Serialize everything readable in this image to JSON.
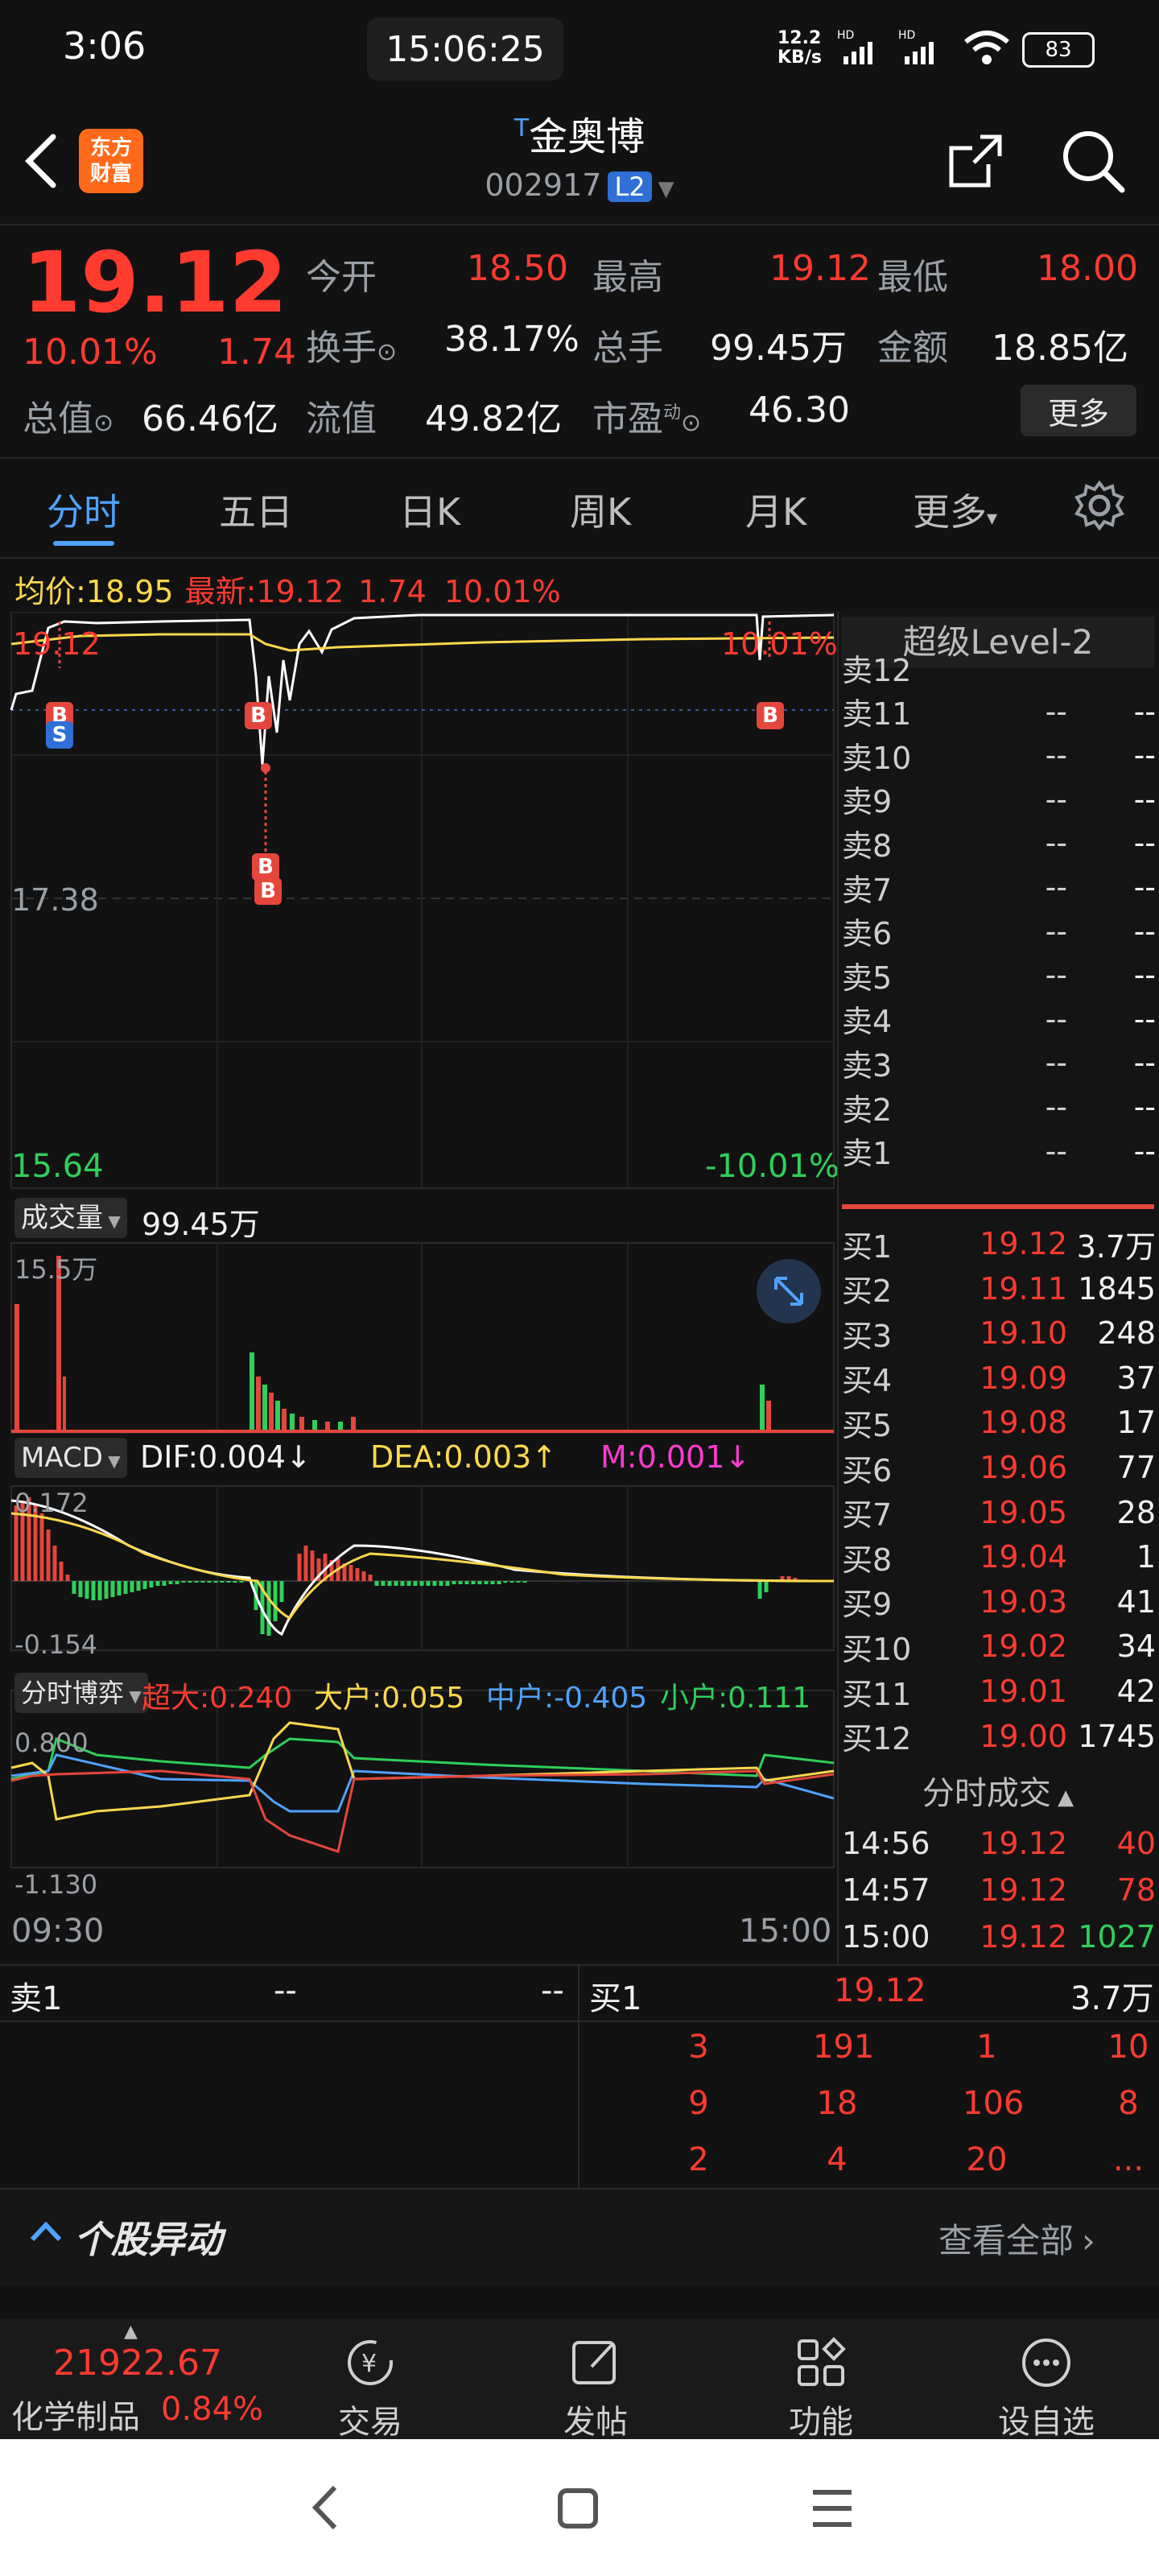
{
  "status_bar": {
    "time": "3:06",
    "center_time": "15:06:25",
    "net_speed_top": "12.2",
    "net_speed_bottom": "KB/s",
    "signal1": "HD",
    "signal2": "HD",
    "battery": "83"
  },
  "header": {
    "title_marker": "T",
    "title": "金奥博",
    "code": "002917",
    "level": "L2"
  },
  "quote": {
    "price": "19.12",
    "change_pct": "10.01%",
    "change": "1.74",
    "open_label": "今开",
    "open": "18.50",
    "high_label": "最高",
    "high": "19.12",
    "low_label": "最低",
    "low": "18.00",
    "turnover_label": "换手",
    "turnover": "38.17%",
    "volume_label": "总手",
    "volume": "99.45万",
    "amount_label": "金额",
    "amount": "18.85亿",
    "mktcap_label": "总值",
    "mktcap": "66.46亿",
    "float_label": "流值",
    "float": "49.82亿",
    "pe_label": "市盈",
    "pe_sup": "动",
    "pe": "46.30",
    "more": "更多"
  },
  "tabs": {
    "t1": "分时",
    "t2": "五日",
    "t3": "日K",
    "t4": "周K",
    "t5": "月K",
    "t6": "更多"
  },
  "intraday": {
    "avg_label": "均价:",
    "avg": "18.95",
    "last_label": "最新:",
    "last": "19.12",
    "last_chg": "1.74",
    "last_pct": "10.01%",
    "top_price": "19.12",
    "top_pct": "10.01%",
    "mid_price": "17.38",
    "low_price": "15.64",
    "low_pct": "-10.01%"
  },
  "volume_panel": {
    "label": "成交量",
    "value": "99.45万",
    "scale": "15.5万"
  },
  "macd_panel": {
    "label": "MACD",
    "dif": "DIF:0.004↓",
    "dea": "DEA:0.003↑",
    "m": "M:0.001↓",
    "top": "0.172",
    "bottom": "-0.154"
  },
  "flow_panel": {
    "label": "分时博弈",
    "super": "超大:0.240",
    "large": "大户:0.055",
    "mid": "中户:-0.405",
    "small": "小户:0.111",
    "top": "0.800",
    "bottom": "-1.130"
  },
  "time_axis": {
    "start": "09:30",
    "end": "15:00"
  },
  "level2": {
    "title": "超级Level-2",
    "sells": [
      {
        "label": "卖12",
        "price": "",
        "qty": ""
      },
      {
        "label": "卖11",
        "price": "--",
        "qty": "--"
      },
      {
        "label": "卖10",
        "price": "--",
        "qty": "--"
      },
      {
        "label": "卖9",
        "price": "--",
        "qty": "--"
      },
      {
        "label": "卖8",
        "price": "--",
        "qty": "--"
      },
      {
        "label": "卖7",
        "price": "--",
        "qty": "--"
      },
      {
        "label": "卖6",
        "price": "--",
        "qty": "--"
      },
      {
        "label": "卖5",
        "price": "--",
        "qty": "--"
      },
      {
        "label": "卖4",
        "price": "--",
        "qty": "--"
      },
      {
        "label": "卖3",
        "price": "--",
        "qty": "--"
      },
      {
        "label": "卖2",
        "price": "--",
        "qty": "--"
      },
      {
        "label": "卖1",
        "price": "--",
        "qty": "--"
      }
    ],
    "buys": [
      {
        "label": "买1",
        "price": "19.12",
        "qty": "3.7万"
      },
      {
        "label": "买2",
        "price": "19.11",
        "qty": "1845"
      },
      {
        "label": "买3",
        "price": "19.10",
        "qty": "248"
      },
      {
        "label": "买4",
        "price": "19.09",
        "qty": "37"
      },
      {
        "label": "买5",
        "price": "19.08",
        "qty": "17"
      },
      {
        "label": "买6",
        "price": "19.06",
        "qty": "77"
      },
      {
        "label": "买7",
        "price": "19.05",
        "qty": "28"
      },
      {
        "label": "买8",
        "price": "19.04",
        "qty": "1"
      },
      {
        "label": "买9",
        "price": "19.03",
        "qty": "41"
      },
      {
        "label": "买10",
        "price": "19.02",
        "qty": "34"
      },
      {
        "label": "买11",
        "price": "19.01",
        "qty": "42"
      },
      {
        "label": "买12",
        "price": "19.00",
        "qty": "1745"
      }
    ],
    "ticks_title": "分时成交",
    "ticks": [
      {
        "time": "14:56",
        "price": "19.12",
        "qty": "40"
      },
      {
        "time": "14:57",
        "price": "19.12",
        "qty": "78"
      },
      {
        "time": "15:00",
        "price": "19.12",
        "qty": "1027"
      }
    ]
  },
  "orderbook_bottom": {
    "sell_label": "卖1",
    "sell_price": "--",
    "sell_qty": "--",
    "buy_label": "买1",
    "buy_price": "19.12",
    "buy_qty": "3.7万",
    "queue": [
      [
        "3",
        "191",
        "1",
        "10"
      ],
      [
        "9",
        "18",
        "106",
        "8"
      ],
      [
        "2",
        "4",
        "20",
        "..."
      ]
    ]
  },
  "news": {
    "title": "个股异动",
    "link": "查看全部"
  },
  "bottom_nav": {
    "index_value": "21922.67",
    "index_name": "化学制品",
    "index_pct": "0.84%",
    "trade": "交易",
    "post": "发帖",
    "func": "功能",
    "watch": "设自选"
  }
}
